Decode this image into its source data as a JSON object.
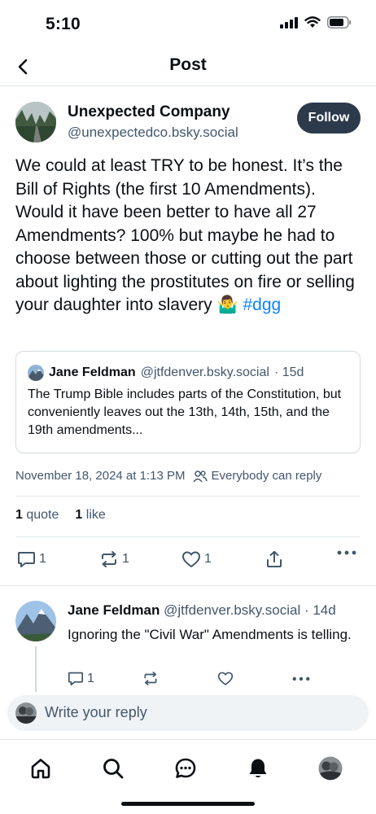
{
  "status_bar": {
    "time": "5:10"
  },
  "header": {
    "title": "Post"
  },
  "post": {
    "author_name": "Unexpected Company",
    "author_handle": "@unexpectedco.bsky.social",
    "follow_label": "Follow",
    "text": "We could at least TRY to be honest. It’s the Bill of Rights (the first 10 Amendments). Would it have been better to have all 27 Amendments? 100% but maybe he had to choose between those or cutting out the part about lighting the prostitutes on fire or selling your daughter into slavery",
    "emoji": "🤷‍♂️",
    "hashtag": "#dgg",
    "timestamp": "November 18, 2024 at 1:13 PM",
    "reply_setting": "Everybody can reply"
  },
  "quote": {
    "author_name": "Jane Feldman",
    "author_handle": "@jtfdenver.bsky.social",
    "age": "· 15d",
    "text": "The Trump Bible includes parts of the Constitution, but conveniently leaves out the 13th, 14th, 15th, and the 19th amendments..."
  },
  "stats": {
    "quote_count": "1",
    "quote_label": "quote",
    "like_count": "1",
    "like_label": "like"
  },
  "actions": {
    "reply_count": "1",
    "repost_count": "1",
    "like_count": "1"
  },
  "reply": {
    "author_name": "Jane Feldman",
    "author_handle": "@jtfdenver.bsky.social",
    "age": "· 14d",
    "text": "Ignoring the \"Civil War\" Amendments is telling.",
    "reply_count": "1"
  },
  "composer": {
    "placeholder": "Write your reply"
  },
  "colors": {
    "accent": "#1083fe",
    "follow_bg": "#2c3a4b",
    "muted_text": "#42576c",
    "border": "#e4e8ec"
  }
}
